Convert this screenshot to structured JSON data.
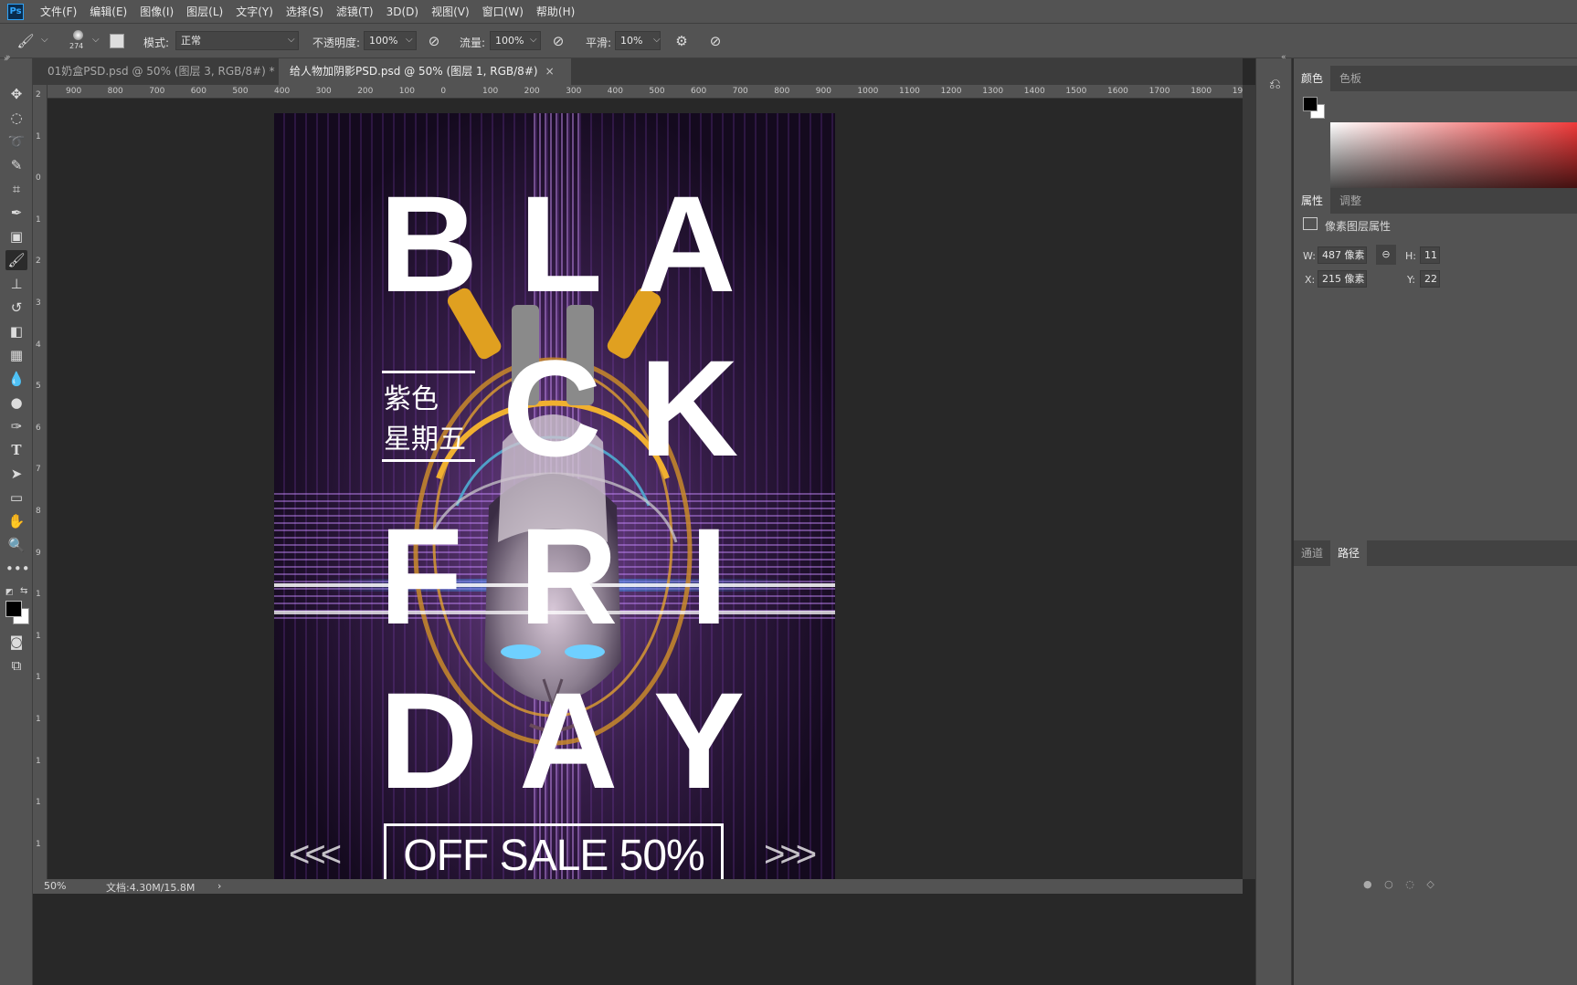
{
  "menubar": {
    "logo": "Ps",
    "items": [
      "文件(F)",
      "编辑(E)",
      "图像(I)",
      "图层(L)",
      "文字(Y)",
      "选择(S)",
      "滤镜(T)",
      "3D(D)",
      "视图(V)",
      "窗口(W)",
      "帮助(H)"
    ]
  },
  "options": {
    "brush_size": "274",
    "mode_label": "模式:",
    "mode_value": "正常",
    "opacity_label": "不透明度:",
    "opacity_value": "100%",
    "flow_label": "流量:",
    "flow_value": "100%",
    "smooth_label": "平滑:",
    "smooth_value": "10%"
  },
  "tabs": [
    {
      "label": "01奶盒PSD.psd @ 50% (图层 3, RGB/8#) *",
      "close": "×"
    },
    {
      "label": "给人物加阴影PSD.psd @ 50% (图层 1, RGB/8#)",
      "close": "×"
    }
  ],
  "ruler_h": [
    "900",
    "800",
    "700",
    "600",
    "500",
    "400",
    "300",
    "200",
    "100",
    "0",
    "100",
    "200",
    "300",
    "400",
    "500",
    "600",
    "700",
    "800",
    "900",
    "1000",
    "1100",
    "1200",
    "1300",
    "1400",
    "1500",
    "1600",
    "1700",
    "1800",
    "1900"
  ],
  "ruler_v": [
    "2",
    "1",
    "0",
    "1",
    "2",
    "3",
    "4",
    "5",
    "6",
    "7",
    "8",
    "9",
    "1",
    "1",
    "1",
    "1",
    "1",
    "1",
    "1"
  ],
  "poster": {
    "letters_row1": [
      "B",
      "L",
      "A"
    ],
    "letters_row2": [
      "C",
      "K"
    ],
    "letters_row3": [
      "F",
      "R",
      "I"
    ],
    "letters_row4": [
      "D",
      "A",
      "Y"
    ],
    "cn_line1": "紫色",
    "cn_line2": "星期五",
    "sale": "OFF  SALE 50%",
    "chev_left": "<<<",
    "chev_right": ">>>"
  },
  "panel": {
    "color_tab": "颜色",
    "swatch_tab": "色板",
    "props_tab": "属性",
    "adjust_tab": "调整",
    "props_title": "像素图层属性",
    "w_label": "W:",
    "w_value": "487 像素",
    "h_label": "H:",
    "h_value": "11",
    "x_label": "X:",
    "x_value": "215 像素",
    "y_label": "Y:",
    "y_value": "22",
    "channels_tab": "通道",
    "paths_tab": "路径"
  },
  "status": {
    "zoom": "50%",
    "doc": "文档:4.30M/15.8M",
    "arrow": "›"
  },
  "colors": {
    "ui_gray": "#535353",
    "canvas_bg": "#282828",
    "poster_purple": "#8a4fd0"
  }
}
